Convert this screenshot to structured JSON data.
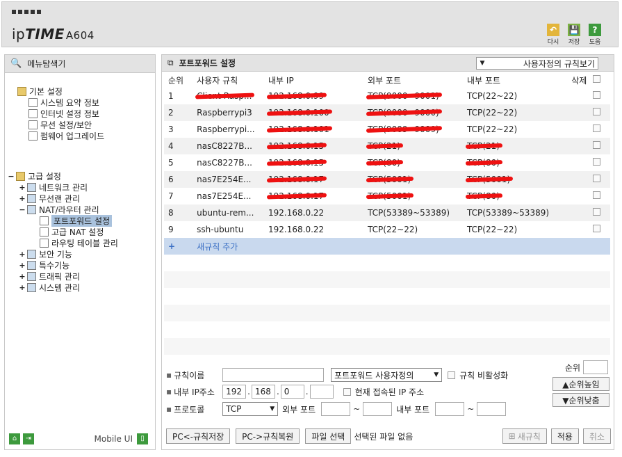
{
  "header": {
    "brand_prefix": "ip",
    "brand_bold": "TIME",
    "model": "A604",
    "buttons": [
      {
        "label": "다시",
        "icon": "undo-icon",
        "color": "#e3b53a",
        "glyph": "↶"
      },
      {
        "label": "저장",
        "icon": "save-icon",
        "color": "#7bb242",
        "glyph": "💾"
      },
      {
        "label": "도움",
        "icon": "help-icon",
        "color": "#3d9a3d",
        "glyph": "?"
      }
    ]
  },
  "sidebar": {
    "title": "메뉴탐색기",
    "basic": {
      "label": "기본 설정",
      "items": [
        "시스템 요약 정보",
        "인터넷 설정 정보",
        "무선 설정/보안",
        "펌웨어 업그레이드"
      ]
    },
    "advanced": {
      "label": "고급 설정",
      "items": [
        {
          "pm": "+",
          "label": "네트워크 관리"
        },
        {
          "pm": "+",
          "label": "무선랜 관리"
        },
        {
          "pm": "−",
          "label": "NAT/라우터 관리"
        },
        {
          "pm": "+",
          "label": "보안 기능"
        },
        {
          "pm": "+",
          "label": "특수기능"
        },
        {
          "pm": "+",
          "label": "트래픽 관리"
        },
        {
          "pm": "+",
          "label": "시스템 관리"
        }
      ],
      "nat_children": [
        "포트포워드 설정",
        "고급 NAT 설정",
        "라우팅 테이블 관리"
      ]
    },
    "footer": {
      "mobile": "Mobile UI"
    }
  },
  "main": {
    "title": "포트포워드 설정",
    "view_select": "사용자정의 규칙보기",
    "columns": [
      "순위",
      "사용자 규칙",
      "내부 IP",
      "외부 포트",
      "내부 포트",
      "삭제"
    ],
    "rows": [
      {
        "no": "1",
        "name": "Client Rasp...",
        "ip": "192.168.0.99",
        "ext": "TCP(9000~9001)",
        "int": "TCP(22~22)",
        "redact": [
          "name",
          "ip",
          "ext"
        ]
      },
      {
        "no": "2",
        "name": "Raspberrypi3",
        "ip": "192.168.0.100",
        "ext": "TCP(9000~9000)",
        "int": "TCP(22~22)",
        "redact": [
          "ip",
          "ext"
        ]
      },
      {
        "no": "3",
        "name": "Raspberrypi...",
        "ip": "192.168.0.101",
        "ext": "TCP(9009~9009)",
        "int": "TCP(22~22)",
        "redact": [
          "ip",
          "ext"
        ]
      },
      {
        "no": "4",
        "name": "nasC8227B...",
        "ip": "192.168.0.15",
        "ext": "TCP(21)",
        "int": "TCP(21)",
        "redact": [
          "ip",
          "ext",
          "int"
        ]
      },
      {
        "no": "5",
        "name": "nasC8227B...",
        "ip": "192.168.0.15",
        "ext": "TCP(80)",
        "int": "TCP(80)",
        "redact": [
          "ip",
          "ext",
          "int"
        ]
      },
      {
        "no": "6",
        "name": "nas7E254E...",
        "ip": "192.168.0.17",
        "ext": "TCP(5001)",
        "int": "TCP(5001)",
        "redact": [
          "ip",
          "ext",
          "int"
        ]
      },
      {
        "no": "7",
        "name": "nas7E254E...",
        "ip": "192.168.0.17",
        "ext": "TCP(5001)",
        "int": "TCP(80)",
        "redact": [
          "ip",
          "ext",
          "int"
        ]
      },
      {
        "no": "8",
        "name": "ubuntu-rem...",
        "ip": "192.168.0.22",
        "ext": "TCP(53389~53389)",
        "int": "TCP(53389~53389)",
        "redact": []
      },
      {
        "no": "9",
        "name": "ssh-ubuntu",
        "ip": "192.168.0.22",
        "ext": "TCP(22~22)",
        "int": "TCP(22~22)",
        "redact": []
      }
    ],
    "add_rule": "새규칙 추가",
    "form": {
      "rule_name_label": "규칙이름",
      "rule_name_value": "",
      "rule_type": "포트포워드 사용자정의",
      "disable_label": "규칙 비활성화",
      "priority_label": "순위",
      "priority_value": "",
      "internal_ip_label": "내부 IP주소",
      "ip": [
        "192",
        "168",
        "0",
        ""
      ],
      "current_ip_label": "현재 접속된 IP 주소",
      "up_label": "▲순위높임",
      "down_label": "▼순위낮춤",
      "protocol_label": "프로토콜",
      "protocol_value": "TCP",
      "ext_port_label": "외부 포트",
      "int_port_label": "내부 포트",
      "tilde": "~"
    },
    "bottom": {
      "save_pc": "PC<-규칙저장",
      "restore_pc": "PC->규칙복원",
      "choose_file": "파일 선택",
      "no_file": "선택된 파일 없음",
      "new_rule": "새규칙",
      "apply": "적용",
      "cancel": "취소"
    }
  }
}
